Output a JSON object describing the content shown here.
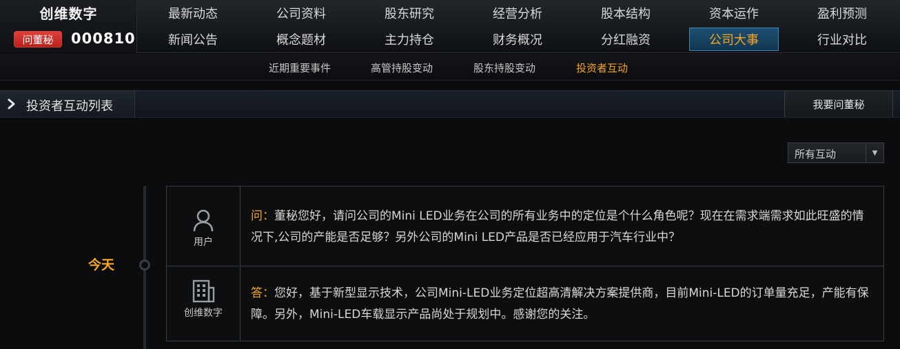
{
  "company": {
    "name": "创维数字",
    "badge": "问董秘",
    "code": "000810"
  },
  "nav": {
    "row1": [
      "最新动态",
      "公司资料",
      "股东研究",
      "经营分析",
      "股本结构",
      "资本运作",
      "盈利预测"
    ],
    "row2": [
      "新闻公告",
      "概念题材",
      "主力持仓",
      "财务概况",
      "分红融资",
      "公司大事",
      "行业对比"
    ],
    "active": "公司大事"
  },
  "subnav": {
    "items": [
      "近期重要事件",
      "高管持股变动",
      "股东持股变动",
      "投资者互动"
    ],
    "active": "投资者互动"
  },
  "section": {
    "title": "投资者互动列表",
    "ask_button": "我要问董秘"
  },
  "filter": {
    "selected": "所有互动"
  },
  "timeline": {
    "date": "今天"
  },
  "qa": {
    "question": {
      "author": "用户",
      "prefix": "问：",
      "text": "董秘您好，请问公司的Mini LED业务在公司的所有业务中的定位是个什么角色呢？现在在需求端需求如此旺盛的情况下,公司的产能是否足够？另外公司的Mini LED产品是否已经应用于汽车行业中？"
    },
    "answer": {
      "author": "创维数字",
      "prefix": "答：",
      "text": "您好，基于新型显示技术，公司Mini-LED业务定位超高清解决方案提供商，目前Mini-LED的订单量充足，产能有保障。另外，Mini-LED车载显示产品尚处于规划中。感谢您的关注。"
    }
  },
  "colors": {
    "accent": "#f5a623",
    "background": "#0b0c0e",
    "active_tab": "#1e4f72",
    "badge_red": "#c8302c"
  },
  "icons": {
    "user": "user-icon",
    "company": "building-icon",
    "section_arrow": "chevron-right-icon",
    "dropdown": "caret-down-icon"
  }
}
